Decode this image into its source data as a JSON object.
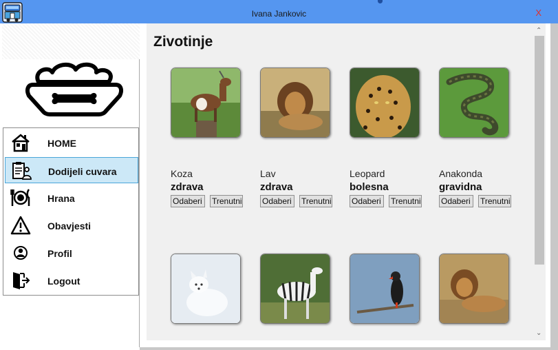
{
  "window": {
    "title": "Ivana Jankovic",
    "close_label": "X",
    "icon": "zoo-bus-icon"
  },
  "logo": {
    "icon": "pet-food-bowl-bone-icon"
  },
  "menu": {
    "items": [
      {
        "label": "HOME",
        "icon": "home-icon",
        "active": false
      },
      {
        "label": "Dodijeli cuvara",
        "icon": "clipboard-worker-icon",
        "active": true
      },
      {
        "label": "Hrana",
        "icon": "plate-cutlery-icon",
        "active": false
      },
      {
        "label": "Obavjesti",
        "icon": "warning-icon",
        "active": false
      },
      {
        "label": "Profil",
        "icon": "user-icon",
        "active": false
      },
      {
        "label": "Logout",
        "icon": "logout-door-icon",
        "active": false
      }
    ]
  },
  "main": {
    "heading": "Zivotinje",
    "animals": [
      {
        "name": "Koza",
        "status": "zdrava",
        "photo": "goat-photo",
        "btn_select": "Odaberi",
        "btn_current": "Trenutni"
      },
      {
        "name": "Lav",
        "status": "zdrava",
        "photo": "lion-photo",
        "btn_select": "Odaberi",
        "btn_current": "Trenutni"
      },
      {
        "name": "Leopard",
        "status": "bolesna",
        "photo": "leopard-photo",
        "btn_select": "Odaberi",
        "btn_current": "Trenutni"
      },
      {
        "name": "Anakonda",
        "status": "gravidna",
        "photo": "anaconda-photo",
        "btn_select": "Odaberi",
        "btn_current": "Trenutni"
      },
      {
        "photo": "arctic-fox-photo"
      },
      {
        "photo": "zebra-photo"
      },
      {
        "photo": "eagle-photo"
      },
      {
        "photo": "lion-lying-photo"
      }
    ]
  },
  "colors": {
    "titlebar": "#5596f0",
    "close": "#e0302c",
    "active_item": "#cce8f7",
    "main_bg": "#f0f0f0"
  }
}
